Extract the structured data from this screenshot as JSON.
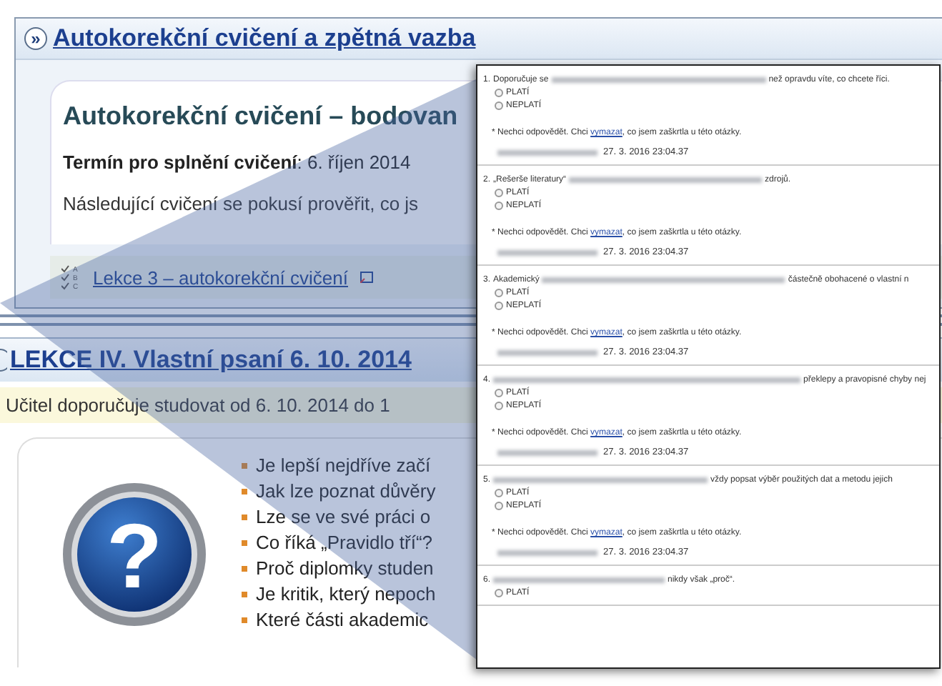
{
  "sections": [
    {
      "icon": "»",
      "title": "Autokorekční cvičení a zpětná vazba",
      "card_title": "Autokorekční cvičení – bodovan",
      "deadline_label": "Termín pro splnění cvičení",
      "deadline_value": ": 6. říjen 2014",
      "description": "Následující cvičení se pokusí prověřit, co js",
      "quiz_letters": [
        "A",
        "B",
        "C"
      ],
      "quiz_link": "Lekce 3 – autokorekční cvičení"
    },
    {
      "title": "LEKCE IV. Vlastní psaní 6. 10. 2014",
      "recommendation": "Učitel doporučuje studovat od 6. 10. 2014 do 1",
      "help_glyph": "?",
      "bullets": [
        "Je lepší nejdříve začí",
        "Jak lze poznat důvěry",
        "Lze se ve své práci o",
        "Co říká „Pravidlo tří“?",
        "Proč diplomky studen",
        "Je kritik, který nepoch",
        "Které části akademic"
      ]
    }
  ],
  "questions": [
    {
      "number": "1.",
      "before": "Doporučuje se",
      "after": "než opravdu víte, co chcete říci.",
      "options": [
        {
          "label": "PLATÍ",
          "selected": false
        },
        {
          "label": "NEPLATÍ",
          "selected": false
        }
      ],
      "note_before": "* Nechci odpovědět. Chci",
      "note_link": "vymazat",
      "note_after": ", co jsem zaškrtla u této otázky.",
      "timestamp": "27. 3. 2016 23:04.37"
    },
    {
      "number": "2.",
      "before": "„Rešerše literatury“",
      "after": "zdrojů.",
      "options": [
        {
          "label": "PLATÍ",
          "selected": false
        },
        {
          "label": "NEPLATÍ",
          "selected": false
        }
      ],
      "note_before": "* Nechci odpovědět. Chci",
      "note_link": "vymazat",
      "note_after": ", co jsem zaškrtla u této otázky.",
      "timestamp": "27. 3. 2016 23:04.37"
    },
    {
      "number": "3.",
      "before": "Akademický",
      "after": "částečně obohacené o vlastní n",
      "options": [
        {
          "label": "PLATÍ",
          "selected": false
        },
        {
          "label": "NEPLATÍ",
          "selected": false
        }
      ],
      "note_before": "* Nechci odpovědět. Chci",
      "note_link": "vymazat",
      "note_after": ", co jsem zaškrtla u této otázky.",
      "timestamp": "27. 3. 2016 23:04.37"
    },
    {
      "number": "4.",
      "after": "překlepy a pravopisné chyby nej",
      "options": [
        {
          "label": "PLATÍ",
          "selected": false
        },
        {
          "label": "NEPLATÍ",
          "selected": false
        }
      ],
      "note_before": "* Nechci odpovědět. Chci",
      "note_link": "vymazat",
      "note_after": ", co jsem zaškrtla u této otázky.",
      "timestamp": "27. 3. 2016 23:04.37"
    },
    {
      "number": "5.",
      "after": "vždy popsat výběr použitých dat a metodu jejich",
      "options": [
        {
          "label": "PLATÍ",
          "selected": false
        },
        {
          "label": "NEPLATÍ",
          "selected": false
        }
      ],
      "note_before": "* Nechci odpovědět. Chci",
      "note_link": "vymazat",
      "note_after": ", co jsem zaškrtla u této otázky.",
      "timestamp": "27. 3. 2016 23:04.37"
    },
    {
      "number": "6.",
      "after": "nikdy však „proč“.",
      "options": [
        {
          "label": "PLATÍ",
          "selected": false
        }
      ]
    }
  ]
}
